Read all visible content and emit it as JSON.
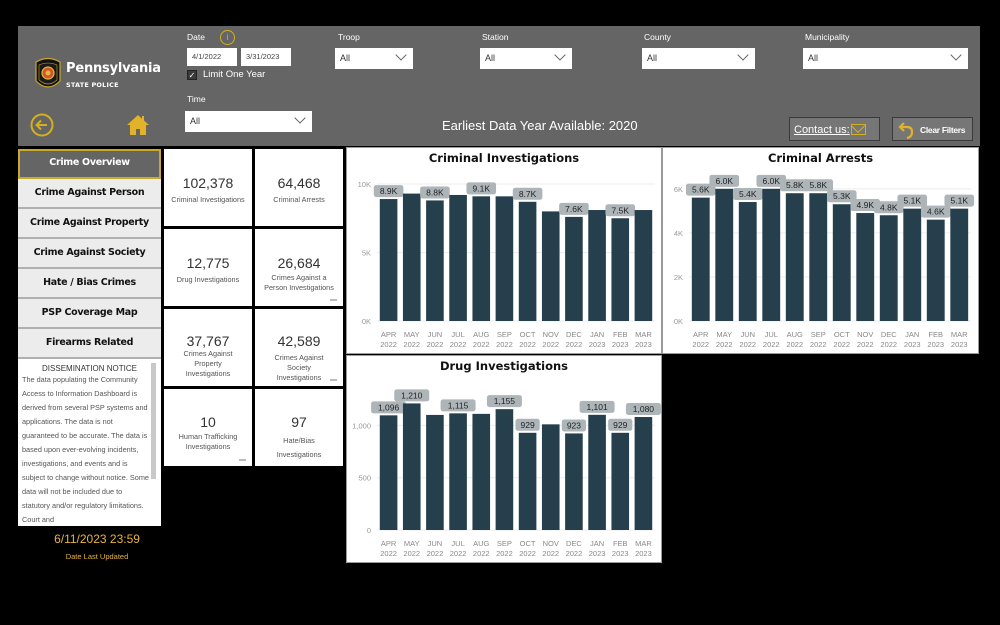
{
  "header": {
    "brand_title": "Pennsylvania",
    "brand_subtitle": "STATE POLICE",
    "date_label": "Date",
    "start_date": "4/1/2022",
    "end_date": "3/31/2023",
    "limit_one_year_label": "Limit One Year",
    "limit_one_year_checked": true,
    "time_label": "Time",
    "time_value": "All",
    "troop_label": "Troop",
    "troop_value": "All",
    "station_label": "Station",
    "station_value": "All",
    "county_label": "County",
    "county_value": "All",
    "municipality_label": "Municipality",
    "municipality_value": "All",
    "earliest_data": "Earliest Data Year Available: 2020",
    "contact_label": "Contact us:",
    "clear_filters_label": "Clear Filters",
    "info_glyph": "i",
    "check_glyph": "✓"
  },
  "nav": {
    "items": [
      {
        "label": "Crime Overview",
        "active": true
      },
      {
        "label": "Crime Against Person"
      },
      {
        "label": "Crime Against Property"
      },
      {
        "label": "Crime Against Society"
      },
      {
        "label": "Hate / Bias Crimes"
      },
      {
        "label": "PSP Coverage Map"
      },
      {
        "label": "Firearms Related"
      }
    ]
  },
  "notice": {
    "title": "DISSEMINATION NOTICE",
    "body": "The data populating the Community Access to Information Dashboard is derived from several PSP systems and applications.  The data is not guaranteed to be accurate.  The data is based upon ever-evolving incidents, investigations, and events and is subject to change without notice.  Some data will not be included due to statutory and/or regulatory limitations.  Court and"
  },
  "last_updated": {
    "value": "6/11/2023 23:59",
    "label": "Date Last Updated"
  },
  "kpis": [
    {
      "value": "102,378",
      "label": "Criminal Investigations"
    },
    {
      "value": "64,468",
      "label": "Criminal Arrests"
    },
    {
      "value": "12,775",
      "label": "Drug Investigations"
    },
    {
      "value": "26,684",
      "label": "Crimes Against a Person Investigations"
    },
    {
      "value": "37,767",
      "label": "Crimes Against Property Investigations"
    },
    {
      "value": "42,589",
      "label": "Crimes Against Society Investigations"
    },
    {
      "value": "10",
      "label": "Human Trafficking Investigations"
    },
    {
      "value": "97",
      "label": "Hate/Bias Investigations"
    }
  ],
  "colors": {
    "header_bg": "#656565",
    "accent_gold": "#d4b020",
    "bar": "#253f4d",
    "label_pill": "#aeb5b9",
    "last_updated": "#e8b43c"
  },
  "chart_data": [
    {
      "type": "bar",
      "title": "Criminal Investigations",
      "categories": [
        "APR 2022",
        "MAY 2022",
        "JUN 2022",
        "JUL 2022",
        "AUG 2022",
        "SEP 2022",
        "OCT 2022",
        "NOV 2022",
        "DEC 2022",
        "JAN 2023",
        "FEB 2023",
        "MAR 2023"
      ],
      "values": [
        8900,
        9300,
        8800,
        9200,
        9100,
        9100,
        8700,
        8000,
        7600,
        8100,
        7500,
        8100
      ],
      "data_labels": [
        "8.9K",
        "",
        "8.8K",
        "",
        "9.1K",
        "",
        "8.7K",
        "",
        "7.6K",
        "",
        "7.5K",
        ""
      ],
      "yticks": [
        0,
        5000,
        10000
      ],
      "ytick_labels": [
        "0K",
        "5K",
        "10K"
      ],
      "ylim": [
        0,
        10000
      ],
      "xlabel": "",
      "ylabel": "",
      "grid": true
    },
    {
      "type": "bar",
      "title": "Criminal Arrests",
      "categories": [
        "APR 2022",
        "MAY 2022",
        "JUN 2022",
        "JUL 2022",
        "AUG 2022",
        "SEP 2022",
        "OCT 2022",
        "NOV 2022",
        "DEC 2022",
        "JAN 2023",
        "FEB 2023",
        "MAR 2023"
      ],
      "values": [
        5600,
        6000,
        5400,
        6000,
        5800,
        5800,
        5300,
        4900,
        4800,
        5100,
        4600,
        5100
      ],
      "data_labels": [
        "5.6K",
        "6.0K",
        "5.4K",
        "6.0K",
        "5.8K",
        "5.8K",
        "5.3K",
        "4.9K",
        "4.8K",
        "5.1K",
        "4.6K",
        "5.1K"
      ],
      "yticks": [
        0,
        2000,
        4000,
        6000
      ],
      "ytick_labels": [
        "0K",
        "2K",
        "4K",
        "6K"
      ],
      "ylim": [
        0,
        6400
      ],
      "xlabel": "",
      "ylabel": "",
      "grid": true
    },
    {
      "type": "bar",
      "title": "Drug Investigations",
      "categories": [
        "APR 2022",
        "MAY 2022",
        "JUN 2022",
        "JUL 2022",
        "AUG 2022",
        "SEP 2022",
        "OCT 2022",
        "NOV 2022",
        "DEC 2022",
        "JAN 2023",
        "FEB 2023",
        "MAR 2023"
      ],
      "values": [
        1096,
        1210,
        1100,
        1115,
        1110,
        1155,
        929,
        1010,
        923,
        1101,
        929,
        1080
      ],
      "data_labels": [
        "1,096",
        "1,210",
        "",
        "1,115",
        "",
        "1,155",
        "929",
        "",
        "923",
        "1,101",
        "929",
        "1,080"
      ],
      "yticks": [
        0,
        500,
        1000
      ],
      "ytick_labels": [
        "0",
        "500",
        "1,000"
      ],
      "ylim": [
        0,
        1300
      ],
      "xlabel": "",
      "ylabel": "",
      "grid": true
    }
  ]
}
